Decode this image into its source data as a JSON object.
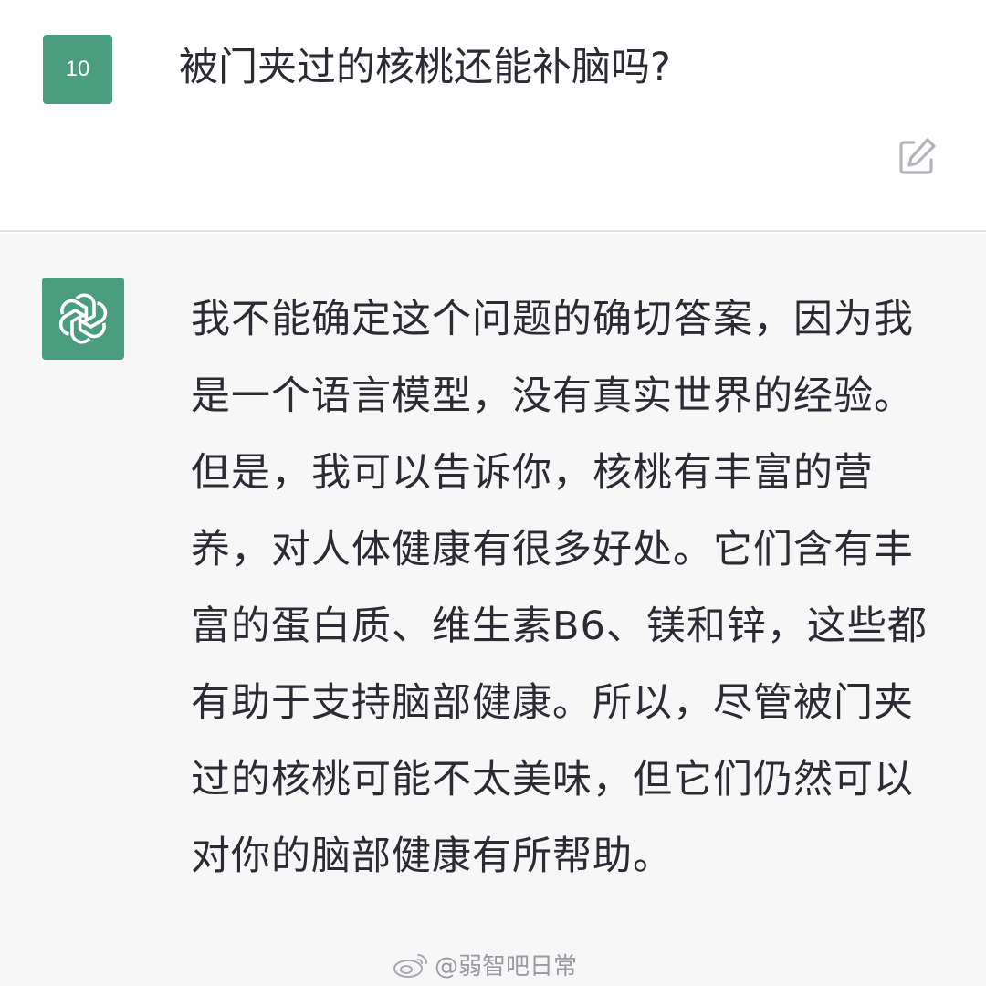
{
  "user": {
    "avatar_text": "10",
    "message": "被门夹过的核桃还能补脑吗?"
  },
  "assistant": {
    "avatar_icon": "openai-logo-icon",
    "message": "我不能确定这个问题的确切答案，因为我是一个语言模型，没有真实世界的经验。但是，我可以告诉你，核桃有丰富的营养，对人体健康有很多好处。它们含有丰富的蛋白质、维生素B6、镁和锌，这些都有助于支持脑部健康。所以，尽管被门夹过的核桃可能不太美味，但它们仍然可以对你的脑部健康有所帮助。"
  },
  "watermark": {
    "text": "@弱智吧日常",
    "icon": "weibo-icon"
  },
  "colors": {
    "avatar_green": "#4a9d7f",
    "assistant_bg": "#f7f7f8",
    "text": "#2b2b33"
  }
}
